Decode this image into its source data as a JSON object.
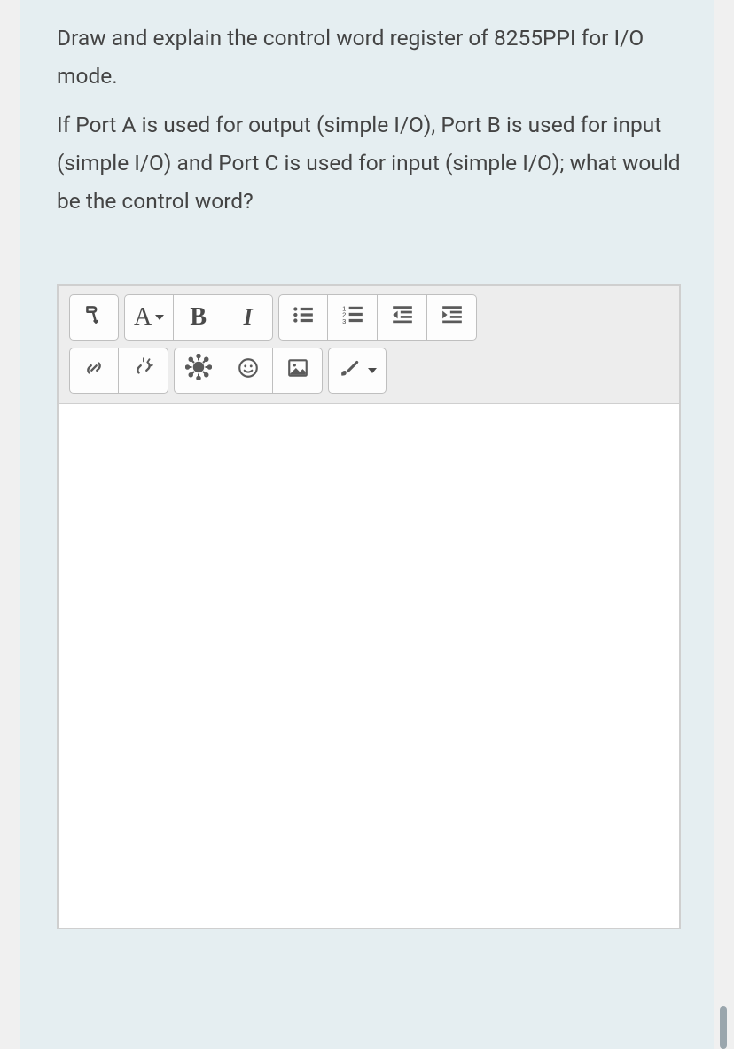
{
  "question": {
    "paragraph1": "Draw and explain the control word register of 8255PPI for I/O mode.",
    "paragraph2": "If Port A is used for output (simple I/O), Port B is used for input (simple I/O) and Port C is used for input (simple I/O); what would be the control word?"
  },
  "toolbar": {
    "font_label": "A",
    "bold_label": "B",
    "italic_label": "I"
  },
  "icons": {
    "paragraph": "paragraph-icon",
    "font": "font-dropdown",
    "bold": "bold-button",
    "italic": "italic-button",
    "bullet_list": "bullet-list-icon",
    "number_list": "number-list-icon",
    "outdent": "outdent-icon",
    "indent": "indent-icon",
    "link": "link-icon",
    "unlink": "unlink-icon",
    "virus": "virus-icon",
    "smiley": "smiley-icon",
    "image": "image-icon",
    "brush": "brush-icon"
  }
}
